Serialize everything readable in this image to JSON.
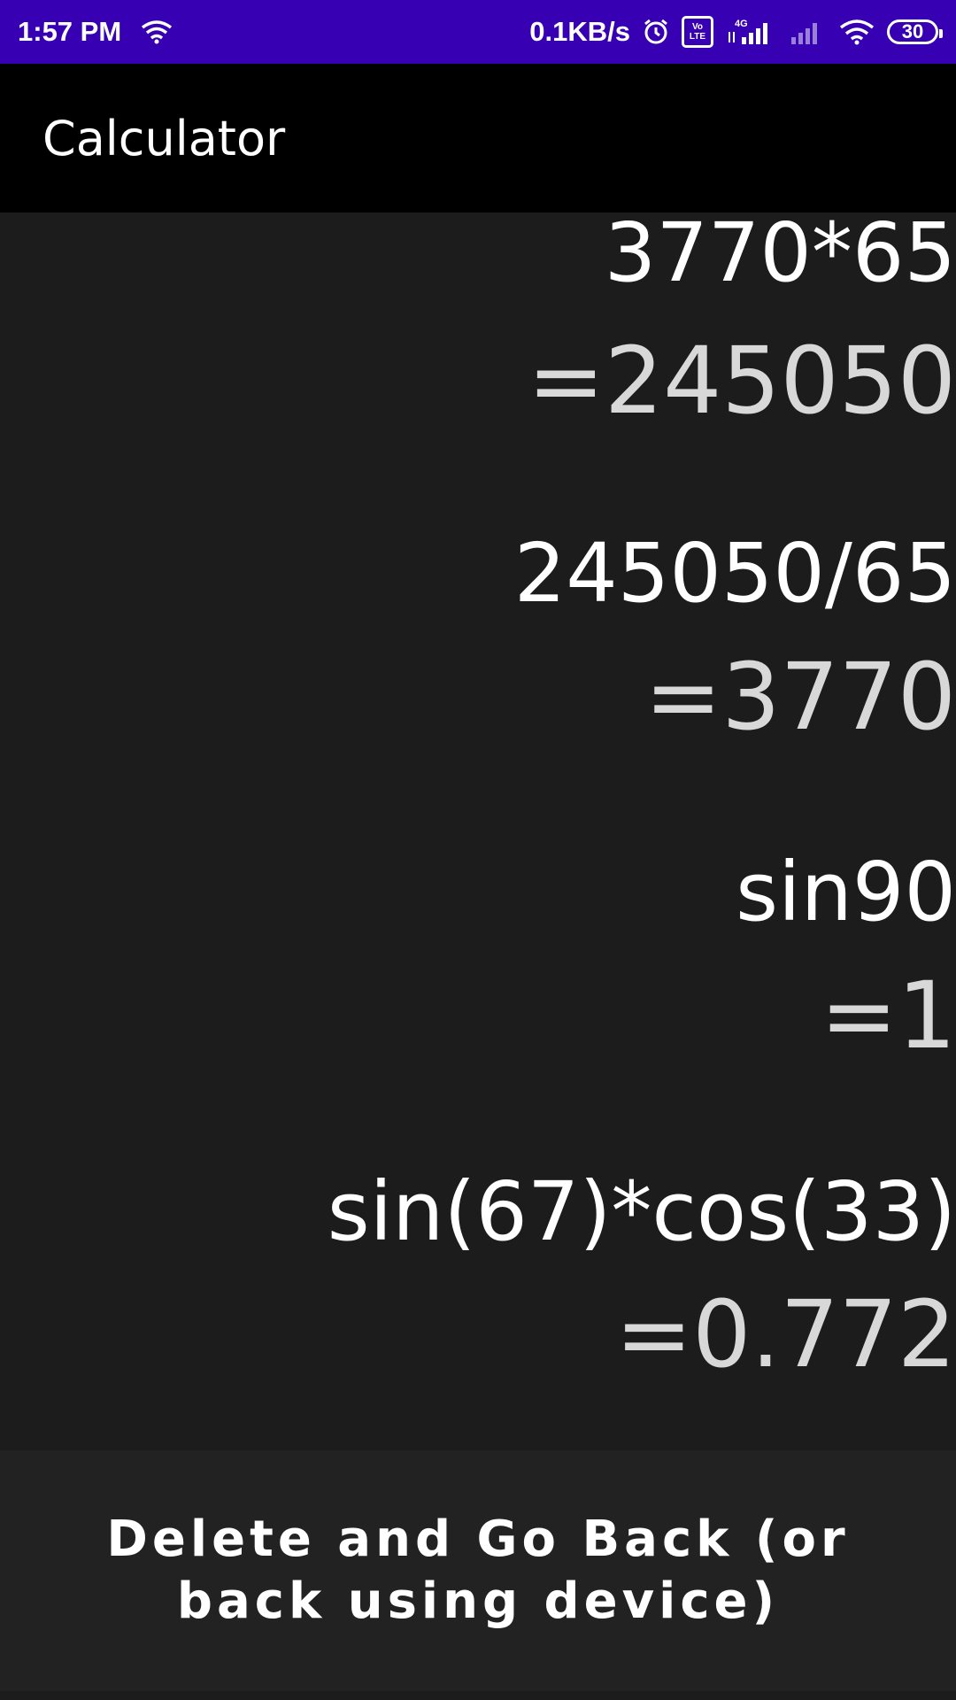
{
  "status_bar": {
    "time": "1:57 PM",
    "net_speed": "0.1KB/s",
    "volte": "Vo\nLTE",
    "network": "4G",
    "battery": "30",
    "icons": [
      "wifi-icon",
      "alarm-icon",
      "volte-icon",
      "signal-icon",
      "signal-weak-icon",
      "wifi-icon",
      "battery-icon"
    ]
  },
  "app_bar": {
    "title": "Calculator"
  },
  "history": [
    {
      "expression": "3770*65",
      "result": "=245050"
    },
    {
      "expression": "245050/65",
      "result": "=3770"
    },
    {
      "expression": "sin90",
      "result": "=1"
    },
    {
      "expression": "sin(67)*cos(33)",
      "result": "=0.772"
    }
  ],
  "actions": {
    "delete_back_label": "Delete and Go Back (or back using device)"
  },
  "colors": {
    "status_bar": "#3700b3",
    "app_bar": "#000000",
    "background": "#1c1c1c",
    "button": "#222222"
  }
}
